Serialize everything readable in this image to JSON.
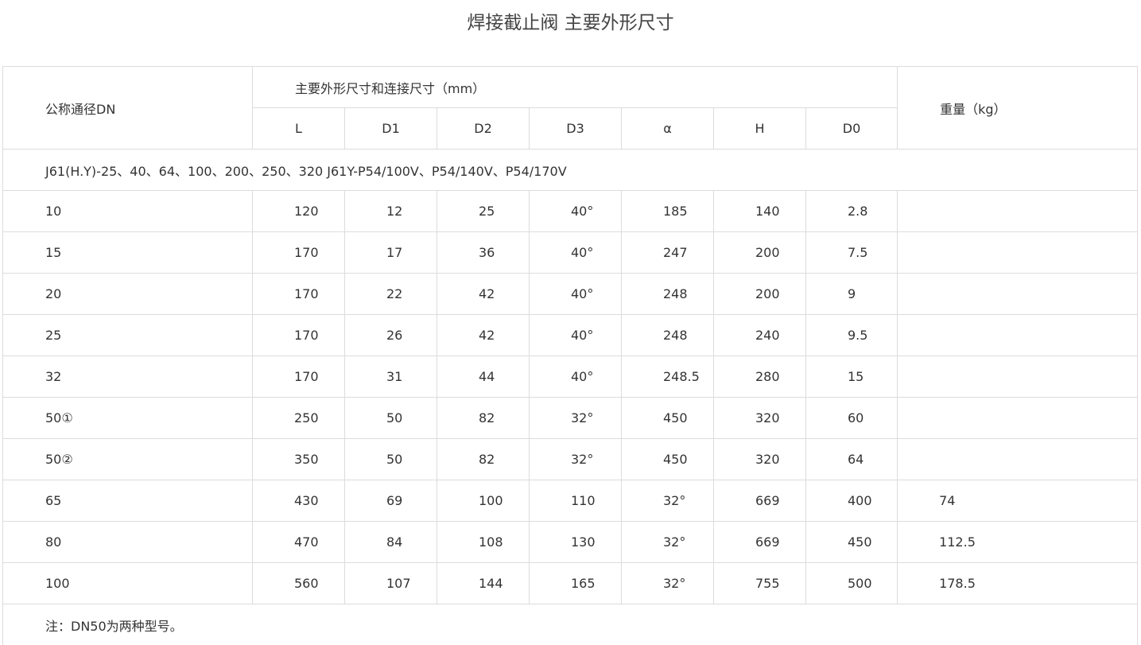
{
  "title": "焊接截止阀 主要外形尺寸",
  "header": {
    "dn_label": "公称通径DN",
    "group_label": "主要外形尺寸和连接尺寸（mm）",
    "weight_label": "重量（kg）",
    "columns": [
      "L",
      "D1",
      "D2",
      "D3",
      "α",
      "H",
      "D0"
    ]
  },
  "model_line": "J61(H.Y)-25、40、64、100、200、250、320 J61Y-P54/100V、P54/140V、P54/170V",
  "rows": [
    {
      "dn": "10",
      "cells": [
        "120",
        "12",
        "25",
        "40°",
        "185",
        "140",
        "2.8",
        ""
      ]
    },
    {
      "dn": "15",
      "cells": [
        "170",
        "17",
        "36",
        "40°",
        "247",
        "200",
        "7.5",
        ""
      ]
    },
    {
      "dn": "20",
      "cells": [
        "170",
        "22",
        "42",
        "40°",
        "248",
        "200",
        "9",
        ""
      ]
    },
    {
      "dn": "25",
      "cells": [
        "170",
        "26",
        "42",
        "40°",
        "248",
        "240",
        "9.5",
        ""
      ]
    },
    {
      "dn": "32",
      "cells": [
        "170",
        "31",
        "44",
        "40°",
        "248.5",
        "280",
        "15",
        ""
      ]
    },
    {
      "dn": "50①",
      "cells": [
        "250",
        "50",
        "82",
        "32°",
        "450",
        "320",
        "60",
        ""
      ]
    },
    {
      "dn": "50②",
      "cells": [
        "350",
        "50",
        "82",
        "32°",
        "450",
        "320",
        "64",
        ""
      ]
    },
    {
      "dn": "65",
      "cells": [
        "430",
        "69",
        "100",
        "110",
        "32°",
        "669",
        "400",
        "74"
      ]
    },
    {
      "dn": "80",
      "cells": [
        "470",
        "84",
        "108",
        "130",
        "32°",
        "669",
        "450",
        "112.5"
      ]
    },
    {
      "dn": "100",
      "cells": [
        "560",
        "107",
        "144",
        "165",
        "32°",
        "755",
        "500",
        "178.5"
      ]
    }
  ],
  "note": "注：DN50为两种型号。"
}
